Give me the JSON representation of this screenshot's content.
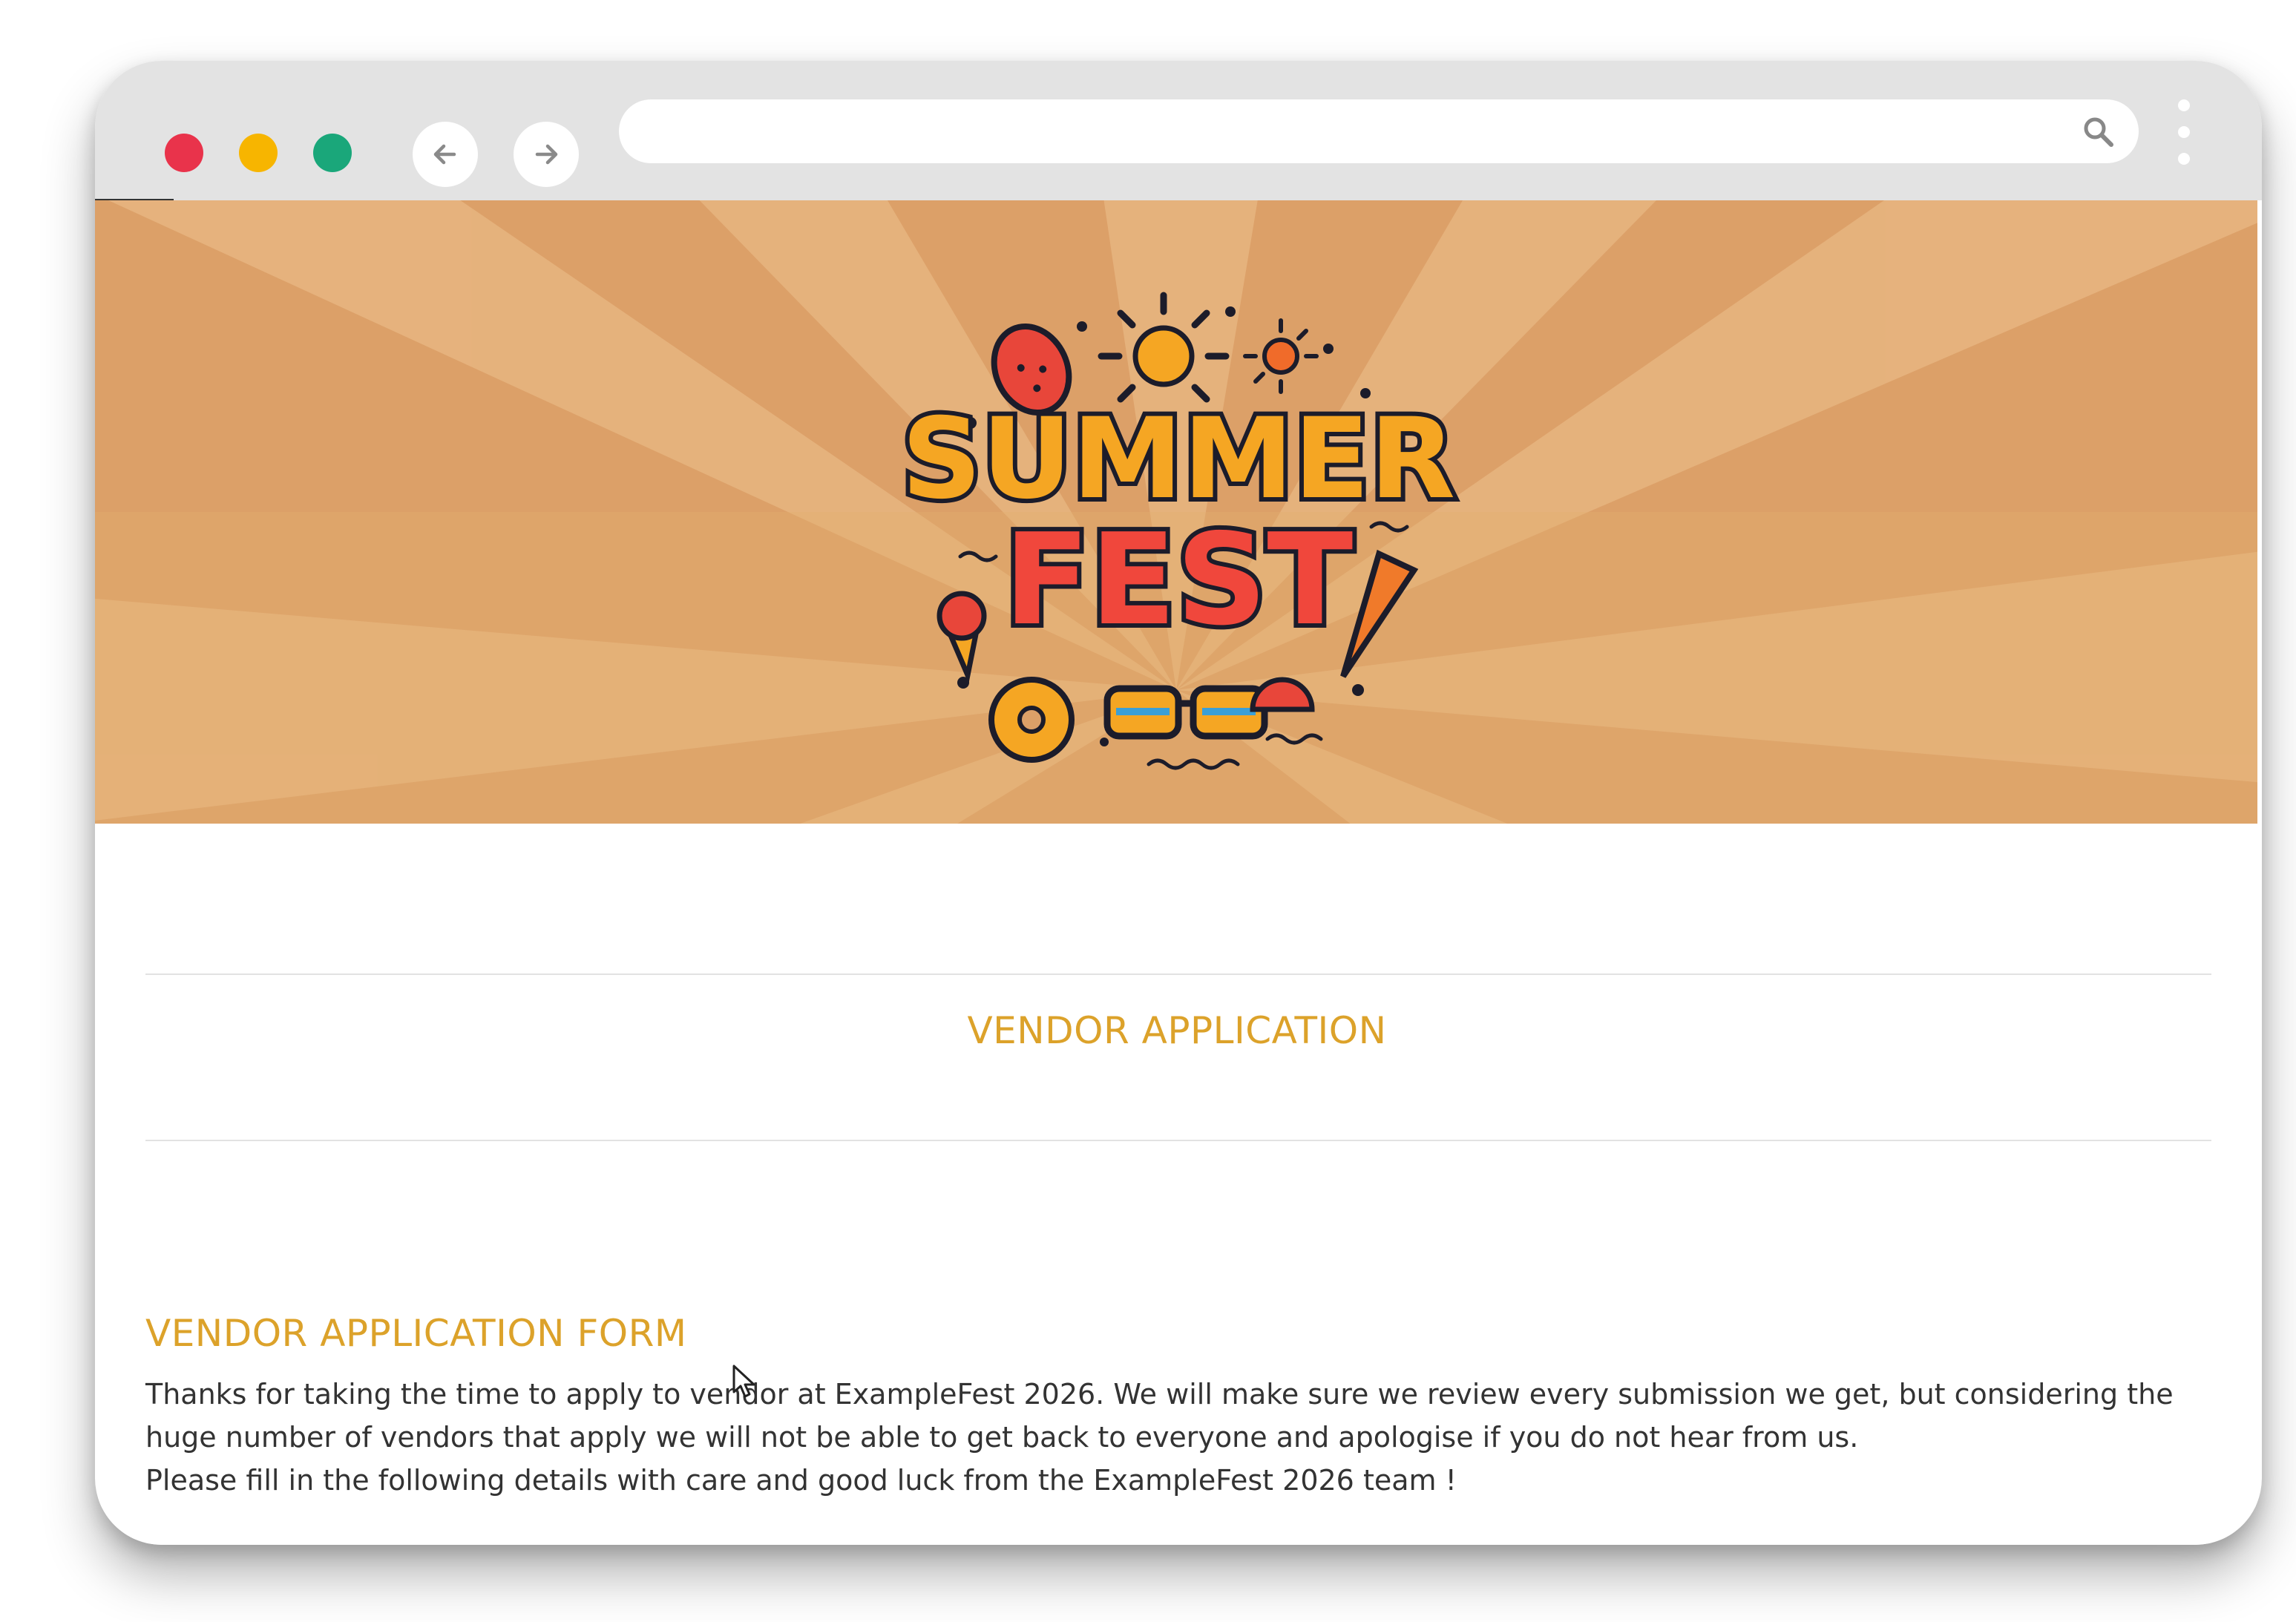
{
  "browser": {
    "traffic_lights": [
      {
        "name": "close",
        "color": "#e9334b"
      },
      {
        "name": "minimize",
        "color": "#f7b500"
      },
      {
        "name": "zoom",
        "color": "#1aa77a"
      }
    ],
    "back_icon": "arrow-left-icon",
    "forward_icon": "arrow-right-icon",
    "url": "",
    "search_icon": "search-icon",
    "menu_icon": "kebab-menu-icon"
  },
  "hero": {
    "logo_line1": "SUMMER",
    "logo_line2": "FEST",
    "background_color": "#e0a970"
  },
  "page": {
    "section_title": "VENDOR APPLICATION",
    "form_title": "VENDOR APPLICATION FORM",
    "intro_paragraph": "Thanks for taking the time to apply to vendor at ExampleFest 2026. We will make sure we review every submission we get, but considering the huge number of vendors that apply we will not be able to get back to everyone and apologise if you do not hear from us.",
    "closing_paragraph": "Please fill in the following details with care and good luck from the ExampleFest 2026 team !",
    "accent_color": "#dca22a"
  }
}
